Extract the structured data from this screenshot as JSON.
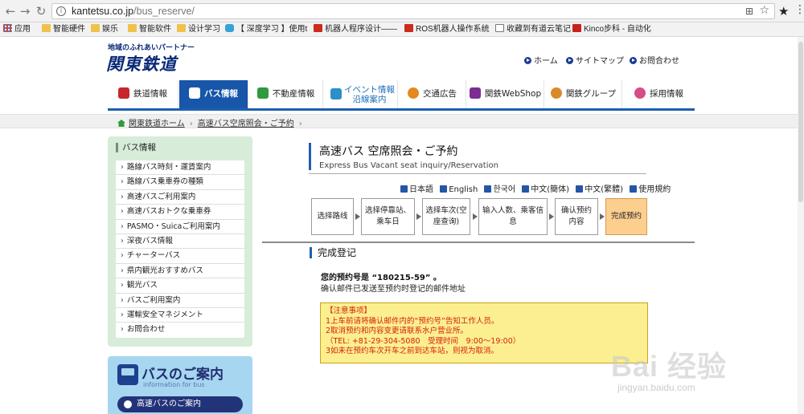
{
  "browser": {
    "url_host": "kantetsu.co.jp",
    "url_path": "/bus_reserve/",
    "bookmarks": [
      "应用",
      "智能硬件",
      "娱乐",
      "智能软件",
      "设计学习",
      "【 深度学习 】使用t",
      "机器人程序设计——",
      "ROS机器人操作系统",
      "收藏到有道云笔记",
      "Kinco步科 - 自动化"
    ]
  },
  "site": {
    "tagline": "地域のふれあいパートナー",
    "logo": "関東鉄道",
    "top_links": [
      "ホーム",
      "サイトマップ",
      "お問合わせ"
    ]
  },
  "main_nav": [
    {
      "label": "鉄道情報",
      "color": "#c4282c"
    },
    {
      "label": "バス情報",
      "color": "#ffffff"
    },
    {
      "label": "不動産情報",
      "color": "#2f9a3e"
    },
    {
      "label": "イベント情報\n沿線案内",
      "color": "#2d8fc9"
    },
    {
      "label": "交通広告",
      "color": "#e38a1e"
    },
    {
      "label": "関鉄WebShop",
      "color": "#7b2d91"
    },
    {
      "label": "関鉄グループ",
      "color": "#d98a2a"
    },
    {
      "label": "採用情報",
      "color": "#d64d8a"
    }
  ],
  "breadcrumb": {
    "home": "関東鉄道ホーム",
    "current": "高速バス空席照会・ご予約"
  },
  "sidebar": {
    "title": "バス情報",
    "items": [
      "路線バス時刻・運賃案内",
      "路線バス乗車券の種類",
      "高速バスご利用案内",
      "高速バスおトクな乗車券",
      "PASMO・Suicaご利用案内",
      "深夜バス情報",
      "チャーターバス",
      "県内観光おすすめバス",
      "観光バス",
      "バスご利用案内",
      "運輸安全マネジメント",
      "お問合わせ"
    ],
    "banner_title": "バスのご案内",
    "banner_sub": "information for bus",
    "banner_button": "高速バスのご案内"
  },
  "content": {
    "title_jp": "高速バス 空席照会・ご予約",
    "title_en": "Express Bus Vacant seat inquiry/Reservation",
    "languages": [
      "日本語",
      "English",
      "한국어",
      "中文(簡体)",
      "中文(繁體)",
      "使用規約"
    ],
    "steps": [
      "选择路线",
      "选择停靠站、乘车日",
      "选择车次(空座查询)",
      "输入人数、乘客信息",
      "确认预约内容",
      "完成预约"
    ],
    "section_title": "完成登记",
    "reservation_line": "您的预约号是 “180215-59” 。",
    "reservation_sub": "确认邮件已发送至预约时登记的邮件地址",
    "notice_title": "【注意事项】",
    "notice_lines": [
      "1上车前请将确认邮件内的“预约号”告知工作人员。",
      "2取消预约和内容变更请联系水户营业所。",
      "（TEL: +81-29-304-5080　受理时间　9:00～19:00）",
      "3如未在预约车次开车之前到达车站，则视为取消。"
    ]
  },
  "watermark": {
    "text": "Bai 经验",
    "url": "jingyan.baidu.com"
  }
}
